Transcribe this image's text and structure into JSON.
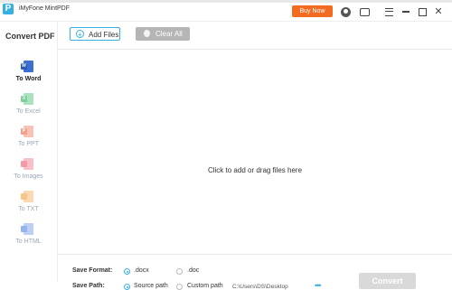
{
  "titlebar": {
    "logo_letter": "P",
    "app_name": "iMyFone MintPDF",
    "buy_now": "Buy Now",
    "close_glyph": "✕"
  },
  "sidebar": {
    "title": "Convert PDF",
    "items": [
      {
        "label": "To Word",
        "icon": "word-icon",
        "letter": "W",
        "color": "#3b6fd4"
      },
      {
        "label": "To Excel",
        "icon": "excel-icon",
        "letter": "X",
        "color": "#7ccf97"
      },
      {
        "label": "To PPT",
        "icon": "ppt-icon",
        "letter": "P",
        "color": "#f2a08c"
      },
      {
        "label": "To Images",
        "icon": "images-icon",
        "letter": "",
        "color": "#f39aa7"
      },
      {
        "label": "To TXT",
        "icon": "txt-icon",
        "letter": "",
        "color": "#f7c58a"
      },
      {
        "label": "To HTML",
        "icon": "html-icon",
        "letter": "",
        "color": "#93b4ee"
      }
    ]
  },
  "toolbar": {
    "add_files": "Add Files",
    "plus": "+",
    "clear_all": "Clear All"
  },
  "dropzone": {
    "text": "Click to add or drag files here"
  },
  "save": {
    "format_label": "Save Format:",
    "format_options": [
      ".docx",
      ".doc"
    ],
    "format_selected": ".docx",
    "path_label": "Save Path:",
    "path_options": [
      "Source path",
      "Custom path"
    ],
    "path_selected": "Source path",
    "custom_path_value": "C:\\Users\\DS\\Desktop",
    "more": "•••"
  },
  "convert_button": "Convert",
  "colors": {
    "accent": "#35b0e3",
    "buy_now": "#f26b21",
    "convert_disabled": "#d9d9d9"
  }
}
